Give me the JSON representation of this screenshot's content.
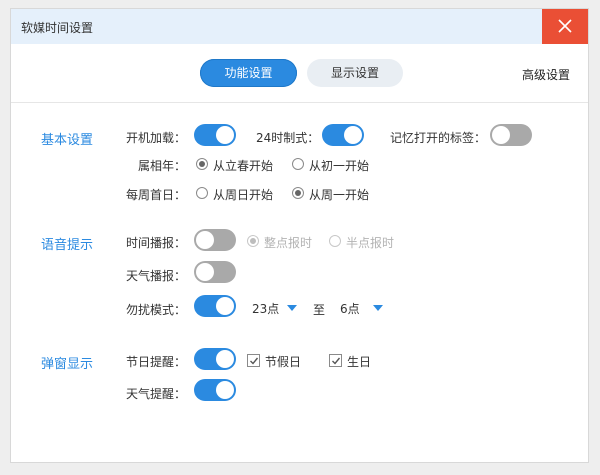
{
  "window": {
    "title": "软媒时间设置"
  },
  "tabs": {
    "function": "功能设置",
    "display": "显示设置",
    "advanced": "高级设置"
  },
  "basic": {
    "title": "基本设置",
    "startup_label": "开机加载：",
    "h24_label": "24时制式：",
    "remember_tabs_label": "记忆打开的标签：",
    "zodiac_label": "属相年：",
    "zodiac_opt1": "从立春开始",
    "zodiac_opt2": "从初一开始",
    "week_label": "每周首日：",
    "week_opt1": "从周日开始",
    "week_opt2": "从周一开始"
  },
  "voice": {
    "title": "语音提示",
    "time_label": "时间播报：",
    "time_opt1": "整点报时",
    "time_opt2": "半点报时",
    "weather_label": "天气播报：",
    "dnd_label": "勿扰模式：",
    "dnd_from": "23点",
    "dnd_to_label": "至",
    "dnd_to": "6点"
  },
  "popup": {
    "title": "弹窗显示",
    "holiday_label": "节日提醒：",
    "holiday_opt1": "节假日",
    "holiday_opt2": "生日",
    "weather_label": "天气提醒："
  },
  "colors": {
    "accent": "#2b8ae0",
    "close": "#ea4f35",
    "toggle_off": "#a9a9a9"
  }
}
